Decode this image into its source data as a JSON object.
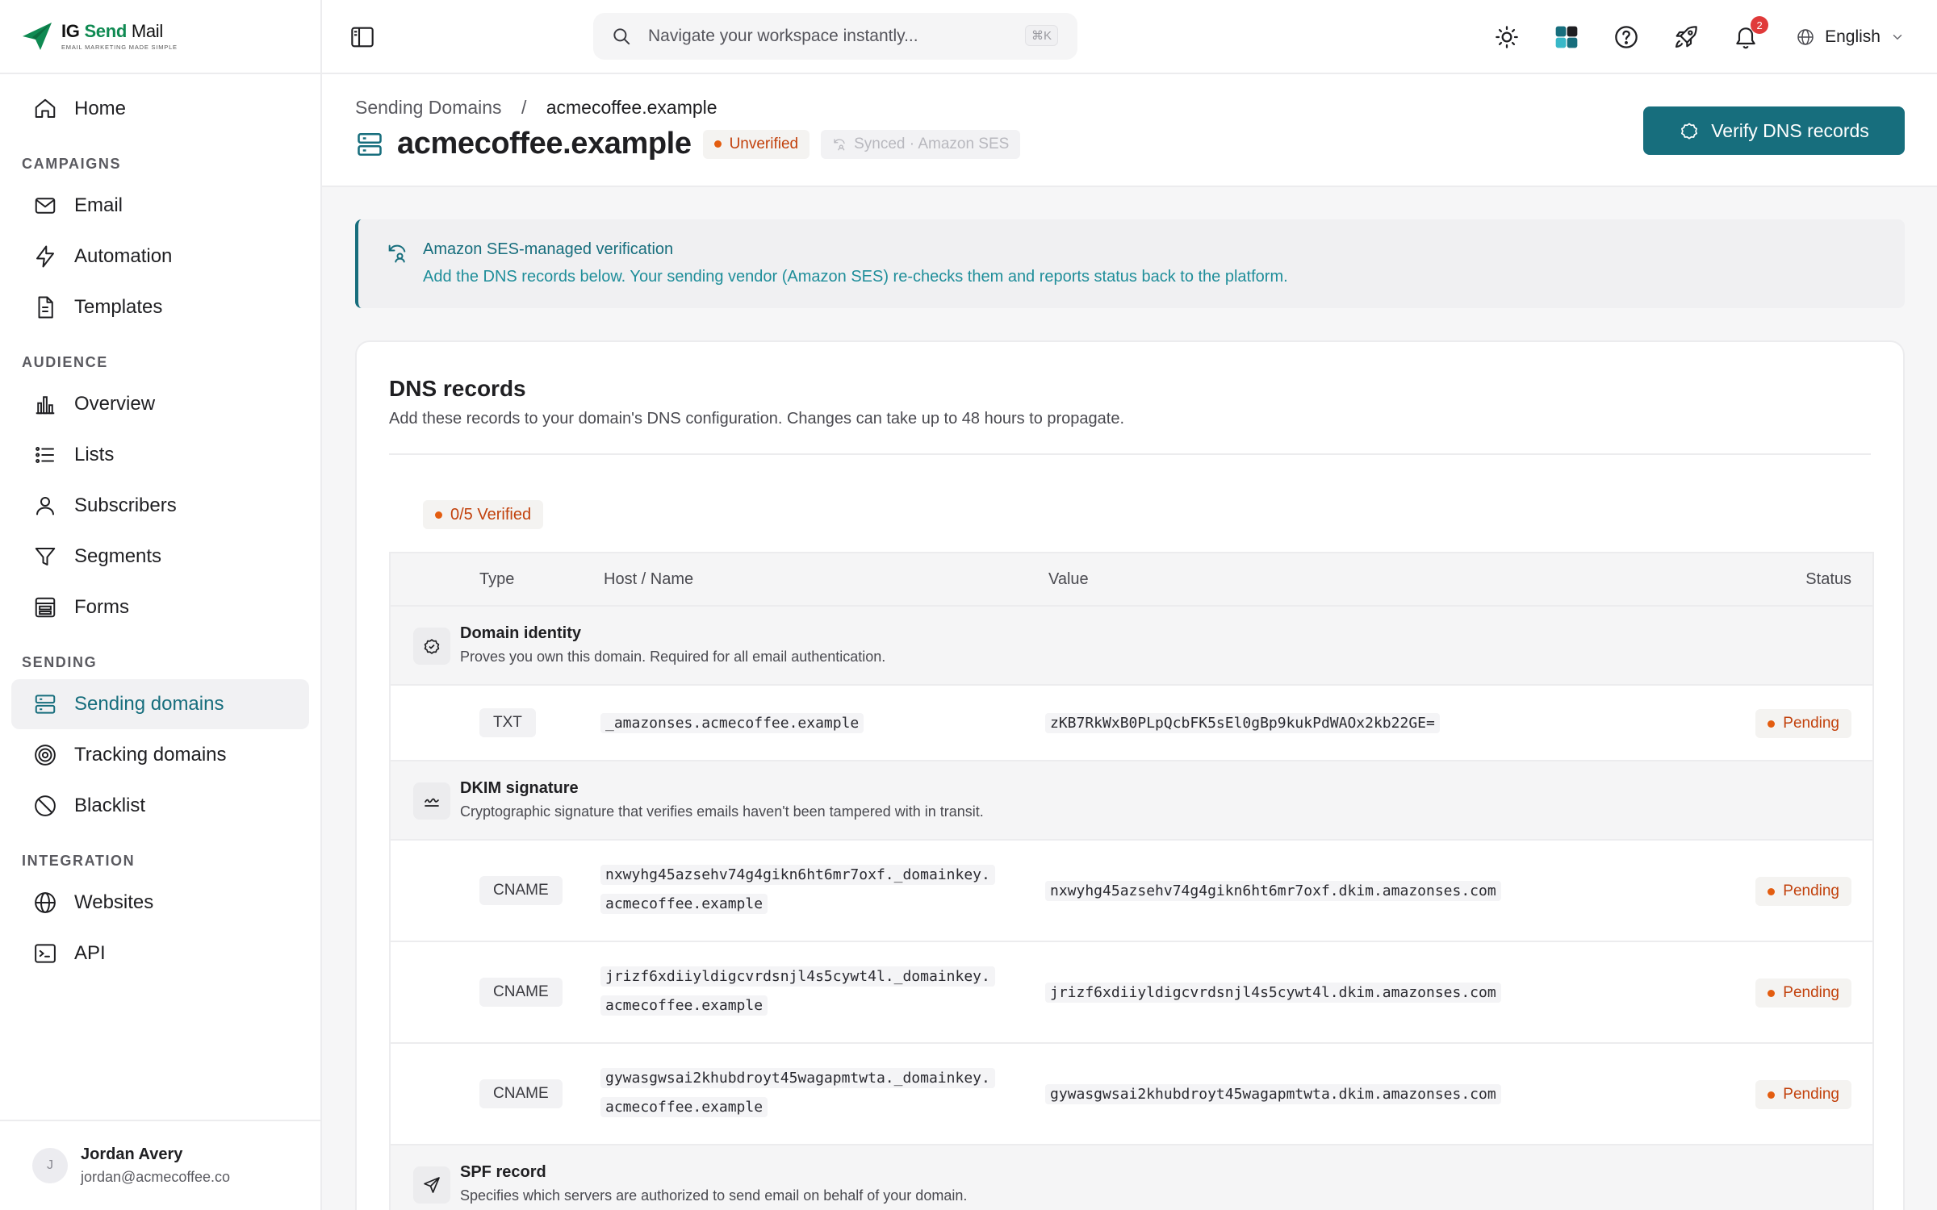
{
  "brand": {
    "name_a": "IG",
    "name_b": "Send",
    "name_c": "Mail",
    "tagline": "EMAIL MARKETING MADE SIMPLE"
  },
  "sidebar": {
    "home": "Home",
    "sections": {
      "campaigns": "CAMPAIGNS",
      "audience": "AUDIENCE",
      "sending": "SENDING",
      "integration": "INTEGRATION"
    },
    "items": {
      "email": "Email",
      "automation": "Automation",
      "templates": "Templates",
      "overview": "Overview",
      "lists": "Lists",
      "subscribers": "Subscribers",
      "segments": "Segments",
      "forms": "Forms",
      "sending_domains": "Sending domains",
      "tracking_domains": "Tracking domains",
      "blacklist": "Blacklist",
      "websites": "Websites",
      "api": "API"
    },
    "user": {
      "initial": "J",
      "name": "Jordan Avery",
      "email": "jordan@acmecoffee.co"
    }
  },
  "topbar": {
    "search_placeholder": "Navigate your workspace instantly...",
    "shortcut": "⌘K",
    "notifications_count": "2",
    "language": "English"
  },
  "header": {
    "breadcrumb_parent": "Sending Domains",
    "breadcrumb_sep": "/",
    "breadcrumb_current": "acmecoffee.example",
    "title": "acmecoffee.example",
    "status": "Unverified",
    "synced": "Synced · Amazon SES",
    "verify_button": "Verify DNS records"
  },
  "banner": {
    "title": "Amazon SES-managed verification",
    "text": "Add the DNS records below. Your sending vendor (Amazon SES) re-checks them and reports status back to the platform."
  },
  "dns": {
    "title": "DNS records",
    "subtitle": "Add these records to your domain's DNS configuration. Changes can take up to 48 hours to propagate.",
    "verified_count": "0/5 Verified",
    "columns": {
      "type": "Type",
      "host": "Host / Name",
      "value": "Value",
      "status": "Status"
    },
    "groups": [
      {
        "title": "Domain identity",
        "desc": "Proves you own this domain. Required for all email authentication.",
        "records": [
          {
            "type": "TXT",
            "host1": "_amazonses.acmecoffee.example",
            "host2": "",
            "value": "zKB7RkWxB0PLpQcbFK5sEl0gBp9kukPdWAOx2kb22GE=",
            "status": "Pending"
          }
        ]
      },
      {
        "title": "DKIM signature",
        "desc": "Cryptographic signature that verifies emails haven't been tampered with in transit.",
        "records": [
          {
            "type": "CNAME",
            "host1": "nxwyhg45azsehv74g4gikn6ht6mr7oxf._domainkey.",
            "host2": "acmecoffee.example",
            "value": "nxwyhg45azsehv74g4gikn6ht6mr7oxf.dkim.amazonses.com",
            "status": "Pending"
          },
          {
            "type": "CNAME",
            "host1": "jrizf6xdiiyldigcvrdsnjl4s5cywt4l._domainkey.",
            "host2": "acmecoffee.example",
            "value": "jrizf6xdiiyldigcvrdsnjl4s5cywt4l.dkim.amazonses.com",
            "status": "Pending"
          },
          {
            "type": "CNAME",
            "host1": "gywasgwsai2khubdroyt45wagapmtwta._domainkey.",
            "host2": "acmecoffee.example",
            "value": "gywasgwsai2khubdroyt45wagapmtwta.dkim.amazonses.com",
            "status": "Pending"
          }
        ]
      },
      {
        "title": "SPF record",
        "desc": "Specifies which servers are authorized to send email on behalf of your domain.",
        "records": []
      }
    ]
  },
  "colors": {
    "accent": "#176e7d",
    "warning": "#c2410c",
    "brand_green": "#0f8a52",
    "badge_red": "#e03a3a"
  }
}
